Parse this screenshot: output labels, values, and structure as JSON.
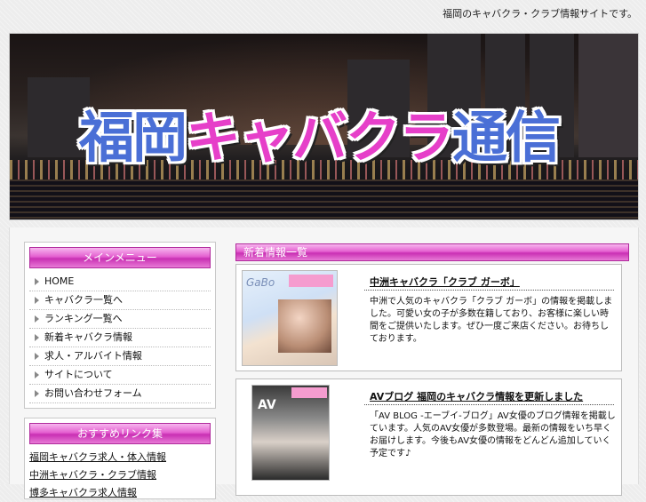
{
  "header": {
    "tagline": "福岡のキャバクラ・クラブ情報サイトです。",
    "title_blue_left": "福岡",
    "title_pink": "キャバクラ",
    "title_blue_right": "通信"
  },
  "sidebar": {
    "menu_title": "メインメニュー",
    "menu_items": [
      {
        "label": "HOME"
      },
      {
        "label": "キャバクラ一覧へ"
      },
      {
        "label": "ランキング一覧へ"
      },
      {
        "label": "新着キャバクラ情報"
      },
      {
        "label": "求人・アルバイト情報"
      },
      {
        "label": "サイトについて"
      },
      {
        "label": "お問い合わせフォーム"
      }
    ],
    "links_title": "おすすめリンク集",
    "links": [
      {
        "label": "福岡キャバクラ求人・体入情報"
      },
      {
        "label": "中洲キャバクラ・クラブ情報"
      },
      {
        "label": "博多キャバクラ求人情報"
      }
    ]
  },
  "main": {
    "section_title": "新着情報一覧",
    "entries": [
      {
        "title": "中洲キャバクラ「クラブ ガーボ」",
        "text": "中洲で人気のキャバクラ「クラブ ガーボ」の情報を掲載しました。可愛い女の子が多数在籍しており、お客様に楽しい時間をご提供いたします。ぜひ一度ご来店ください。お待ちしております。"
      },
      {
        "title": "AVブログ 福岡のキャバクラ情報を更新しました",
        "text": "「AV BLOG -エーブイ-ブログ」AV女優のブログ情報を掲載しています。人気のAV女優が多数登場。最新の情報をいち早くお届けします。今後もAV女優の情報をどんどん追加していく予定です♪"
      }
    ]
  }
}
